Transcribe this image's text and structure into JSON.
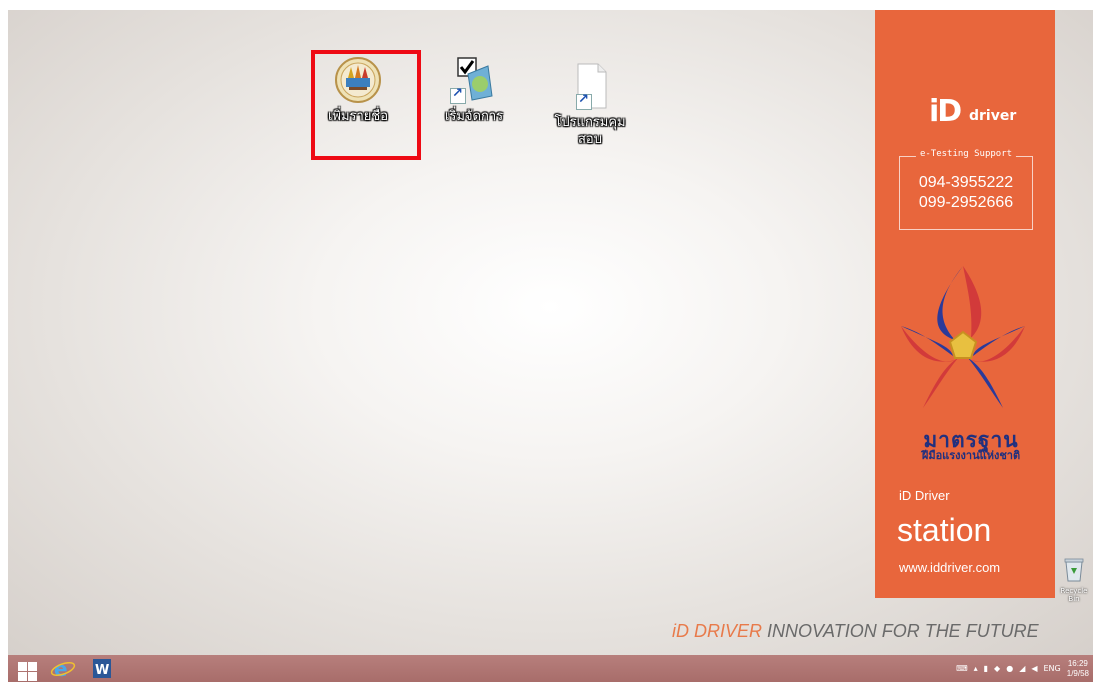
{
  "desktop": {
    "icons": [
      {
        "label_line1": "เพิ่มรายชื่อ",
        "label_line2": "",
        "icon": "government-seal-icon",
        "highlighted": true
      },
      {
        "label_line1": "เริ่มจัดการ",
        "label_line2": "",
        "icon": "checklist-app-shortcut-icon",
        "highlighted": false
      },
      {
        "label_line1": "โปรแกรมคุม",
        "label_line2": "สอบ",
        "icon": "blank-document-shortcut-icon",
        "highlighted": false
      }
    ],
    "recycle_bin_label": "Recycle Bin",
    "highlight_color": "#ee0a14"
  },
  "side_panel": {
    "logo_i": "iD",
    "logo_word": "driver",
    "support_title": "e-Testing Support",
    "phone_1": "094-3955222",
    "phone_2": "099-2952666",
    "emblem_text": "มาตรฐาน",
    "emblem_subtext": "ฝีมือแรงงานแห่งชาติ",
    "product_line": "iD Driver",
    "product_name": "station",
    "website": "www.iddriver.com",
    "background_color": "#e8663c"
  },
  "tagline": {
    "accent": "iD DRIVER",
    "rest": " INNOVATION FOR THE FUTURE"
  },
  "taskbar": {
    "pinned": [
      "windows-start-icon",
      "internet-explorer-icon",
      "word-icon"
    ],
    "tray_lang": "ENG",
    "clock_time": "16:29",
    "clock_date": "1/9/58"
  }
}
